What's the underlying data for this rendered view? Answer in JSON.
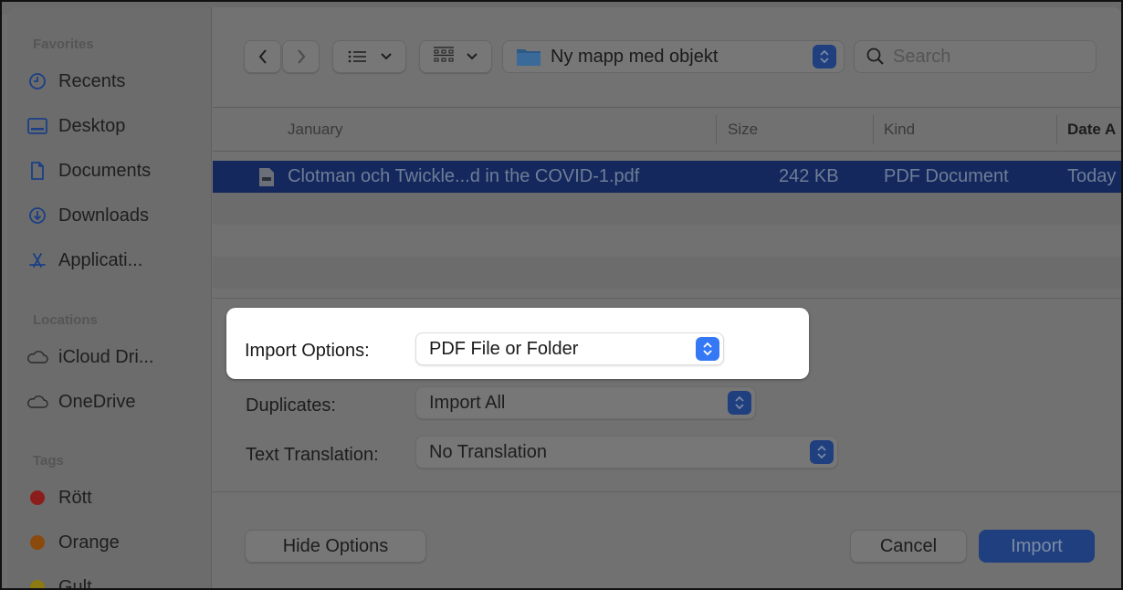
{
  "sidebar": {
    "sections": {
      "favorites": "Favorites",
      "locations": "Locations",
      "tags": "Tags"
    },
    "favorites": [
      {
        "label": "Recents",
        "icon": "clock-icon"
      },
      {
        "label": "Desktop",
        "icon": "desktop-icon"
      },
      {
        "label": "Documents",
        "icon": "document-icon"
      },
      {
        "label": "Downloads",
        "icon": "download-icon"
      },
      {
        "label": "Applicati...",
        "icon": "applications-icon"
      }
    ],
    "locations": [
      {
        "label": "iCloud Dri...",
        "icon": "cloud-icon"
      },
      {
        "label": "OneDrive",
        "icon": "cloud-icon"
      }
    ],
    "tags": [
      {
        "label": "Rött",
        "color": "#8c1d1d"
      },
      {
        "label": "Orange",
        "color": "#8a4a0c"
      },
      {
        "label": "Gult",
        "color": "#8d7a10"
      }
    ]
  },
  "toolbar": {
    "back_icon": "chevron-left-icon",
    "forward_icon": "chevron-right-icon",
    "list_view_icon": "list-icon",
    "group_icon": "grid-icon",
    "current_folder": "Ny mapp med objekt",
    "search_placeholder": "Search"
  },
  "file_list": {
    "columns": {
      "name": "January",
      "size": "Size",
      "kind": "Kind",
      "date": "Date A"
    },
    "rows": [
      {
        "name": "Clotman och Twickle...d in the COVID-1.pdf",
        "size": "242 KB",
        "kind": "PDF Document",
        "date": "Today",
        "selected": true
      }
    ]
  },
  "options": {
    "import_options": {
      "label": "Import Options:",
      "value": "PDF File or Folder"
    },
    "duplicates": {
      "label": "Duplicates:",
      "value": "Import All"
    },
    "text_translation": {
      "label": "Text Translation:",
      "value": "No Translation"
    }
  },
  "footer": {
    "hide_options": "Hide Options",
    "cancel": "Cancel",
    "import": "Import"
  },
  "colors": {
    "accent": "#3478f6",
    "selection_dimmed": "#14285e",
    "highlight_background": "#ffffff"
  }
}
